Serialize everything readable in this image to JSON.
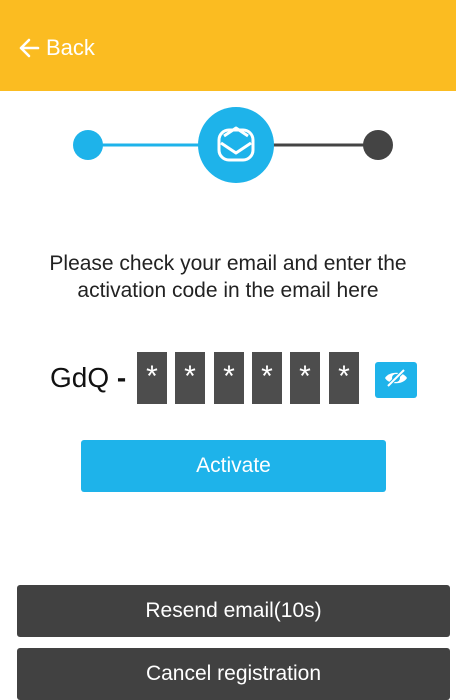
{
  "header": {
    "back_label": "Back",
    "background": "#FBBC21"
  },
  "stepper": {
    "steps": [
      "completed",
      "current",
      "pending"
    ],
    "current_icon": "email-icon",
    "active_color": "#1EB3EA",
    "inactive_color": "#444444"
  },
  "message": {
    "line1": "Please check your email and enter the",
    "line2": "activation code in the email here"
  },
  "code": {
    "prefix": "GdQ",
    "separator": "-",
    "masked_chars": [
      "*",
      "*",
      "*",
      "*",
      "*",
      "*"
    ],
    "toggle_icon": "eye-off-icon"
  },
  "buttons": {
    "activate": "Activate",
    "resend": "Resend email(10s)",
    "cancel": "Cancel registration"
  }
}
